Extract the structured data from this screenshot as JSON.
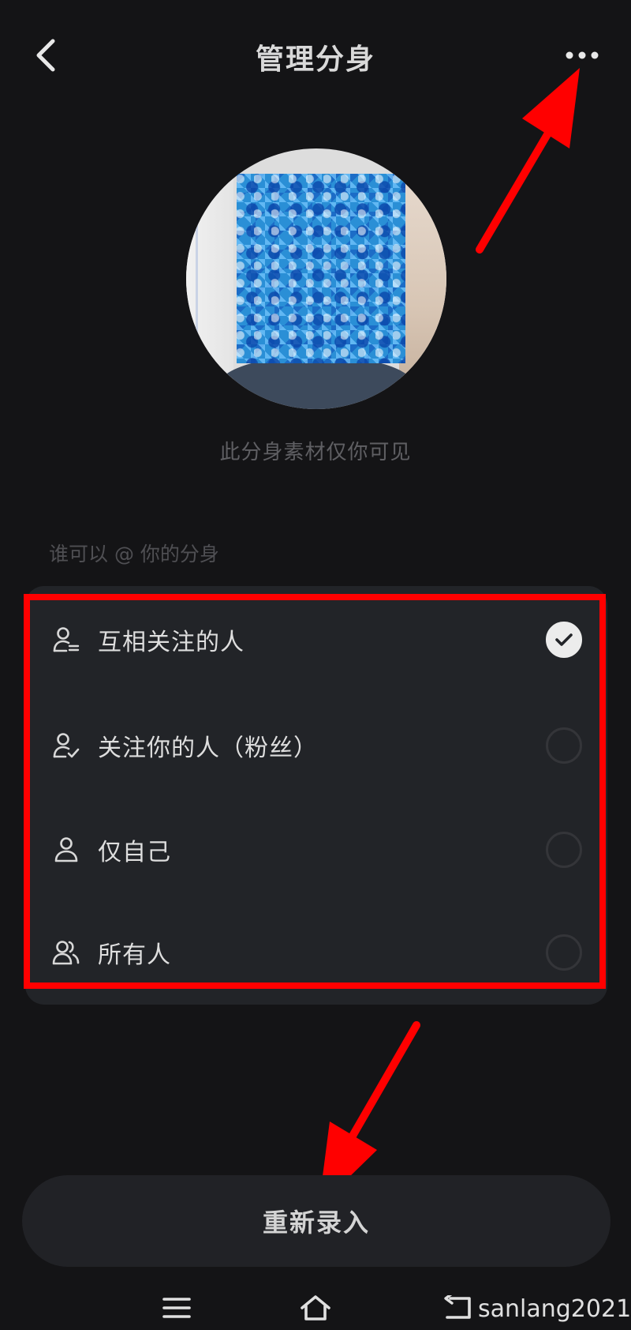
{
  "header": {
    "title": "管理分身",
    "back_icon": "chevron-left-icon",
    "more_icon": "more-horizontal-icon"
  },
  "avatar": {
    "caption": "此分身素材仅你可见"
  },
  "visibility": {
    "section_label": "谁可以 @ 你的分身",
    "options": [
      {
        "label": "互相关注的人",
        "icon": "mutual-follow-icon",
        "selected": true
      },
      {
        "label": "关注你的人（粉丝）",
        "icon": "follower-icon",
        "selected": false
      },
      {
        "label": "仅自己",
        "icon": "self-icon",
        "selected": false
      },
      {
        "label": "所有人",
        "icon": "everyone-icon",
        "selected": false
      }
    ]
  },
  "actions": {
    "re_record_label": "重新录入"
  },
  "system_nav": {
    "menu_icon": "menu-icon",
    "home_icon": "home-icon",
    "back_icon": "return-icon"
  },
  "watermark": "sanlang2021",
  "colors": {
    "background": "#141416",
    "card": "#222428",
    "annotation": "#ff0000",
    "checked": "#ececec"
  }
}
